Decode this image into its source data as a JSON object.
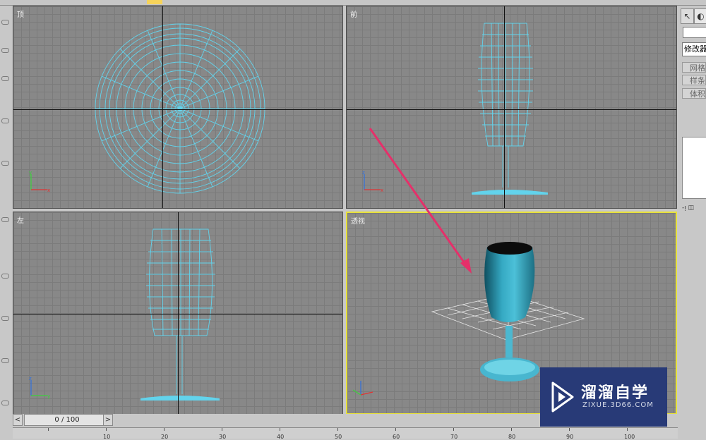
{
  "viewports": {
    "top": {
      "label": "顶"
    },
    "front": {
      "label": "前"
    },
    "left": {
      "label": "左"
    },
    "persp": {
      "label": "透视"
    }
  },
  "command_panel": {
    "modifier_list": "修改器列表",
    "buttons": [
      "网格编辑",
      "样条线编辑",
      "体积选择"
    ]
  },
  "timeline": {
    "frame_display": "0 / 100",
    "prev": "<",
    "next": ">",
    "ruler_ticks": [
      "10",
      "20",
      "30",
      "40",
      "50",
      "60",
      "70",
      "80",
      "90",
      "100"
    ]
  },
  "watermark": {
    "title": "溜溜自学",
    "subtitle": "ZIXUE.3D66.COM"
  },
  "colors": {
    "viewport_bg": "#888888",
    "wireframe": "#62d3ec",
    "active_border": "#e8e23a",
    "annotation_arrow": "#e5306a"
  }
}
